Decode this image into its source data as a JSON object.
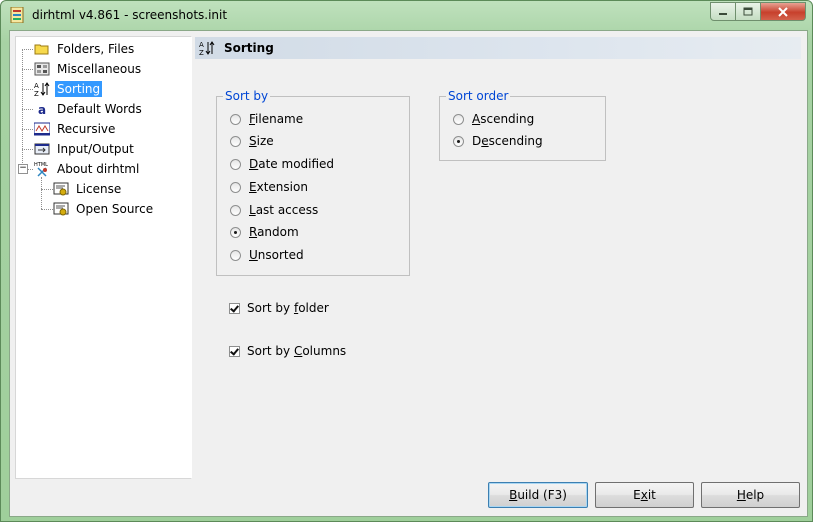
{
  "window": {
    "title": "dirhtml v4.861 - screenshots.init"
  },
  "tree": {
    "items": [
      {
        "label": "Folders, Files"
      },
      {
        "label": "Miscellaneous"
      },
      {
        "label": "Sorting",
        "selected": true
      },
      {
        "label": "Default Words"
      },
      {
        "label": "Recursive"
      },
      {
        "label": "Input/Output"
      },
      {
        "label": "About dirhtml",
        "expanded": true
      },
      {
        "label": "License"
      },
      {
        "label": "Open Source"
      }
    ]
  },
  "panel": {
    "title": "Sorting"
  },
  "sort_by": {
    "title": "Sort by",
    "options": [
      {
        "label": "Filename",
        "mnemonic": "F"
      },
      {
        "label": "Size",
        "mnemonic": "S"
      },
      {
        "label": "Date modified",
        "mnemonic": "D"
      },
      {
        "label": "Extension",
        "mnemonic": "E"
      },
      {
        "label": "Last access",
        "mnemonic": "L"
      },
      {
        "label": "Random",
        "mnemonic": "R"
      },
      {
        "label": "Unsorted",
        "mnemonic": "U"
      }
    ],
    "selected": "Random"
  },
  "sort_order": {
    "title": "Sort order",
    "options": [
      {
        "label": "Ascending",
        "mnemonic": "A"
      },
      {
        "label": "Descending",
        "mnemonic": "e"
      }
    ],
    "selected": "Descending"
  },
  "checkboxes": [
    {
      "label": "Sort by folder",
      "checked": true
    },
    {
      "label": "Sort by Columns",
      "checked": true
    }
  ],
  "buttons": {
    "build": "Build (F3)",
    "exit": "Exit",
    "help": "Help"
  },
  "colors": {
    "group_title": "#0046d5",
    "selection": "#3399ff",
    "close_button": "#c7402c",
    "frame": "#9fcf9b"
  }
}
